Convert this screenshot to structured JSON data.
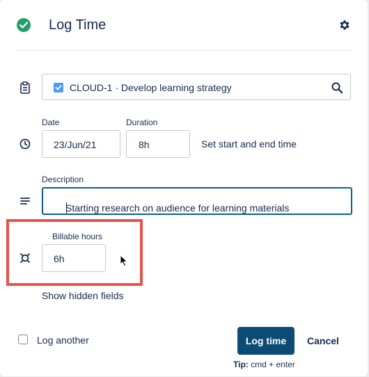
{
  "header": {
    "title": "Log Time",
    "status_icon": "check-circle-icon",
    "settings_icon": "gear-icon"
  },
  "issue": {
    "text": "CLOUD-1 · Develop learning strategy",
    "icon": "clipboard-icon",
    "search_icon": "search-icon"
  },
  "date": {
    "label": "Date",
    "value": "23/Jun/21",
    "icon": "clock-icon"
  },
  "duration": {
    "label": "Duration",
    "value": "8h"
  },
  "set_time_link": "Set start and end time",
  "description": {
    "label": "Description",
    "value": "Starting research on audience for learning materials",
    "icon": "align-left-icon"
  },
  "billable": {
    "label": "Billable hours",
    "value": "6h",
    "icon": "currency-icon"
  },
  "show_hidden_fields": "Show hidden fields",
  "footer": {
    "log_another_label": "Log another",
    "log_another_checked": false,
    "log_time_button": "Log time",
    "cancel_button": "Cancel",
    "tip_prefix": "Tip:",
    "tip_text": "cmd + enter"
  },
  "colors": {
    "accent": "#0c4b73",
    "success": "#22a06b",
    "highlight": "#e5534b",
    "focus_border": "#0c5f8c"
  }
}
